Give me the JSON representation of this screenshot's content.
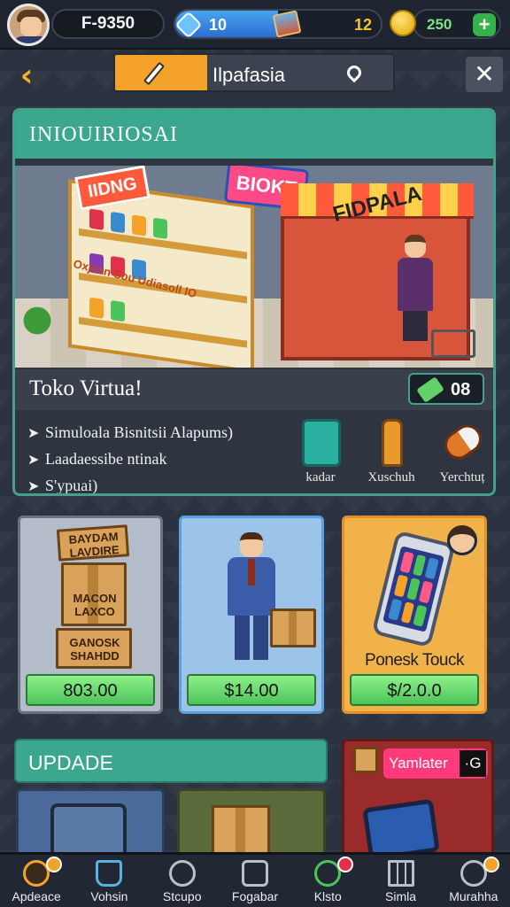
{
  "hud": {
    "money": "F-9350",
    "level": "10",
    "level_progress": 0.5,
    "level_right": "12",
    "gems": "250",
    "plus": "+"
  },
  "location": {
    "back_label": "‹",
    "name": "Ilpafasia",
    "close_label": "✕"
  },
  "store_card": {
    "header": "INIOUIRIOSAI",
    "signs": [
      "BIOKT",
      "IIDNG",
      "FIDPALA"
    ],
    "shop_label": "Oxjean Sou Udiasoll lO",
    "title": "Toko Virtua!",
    "badge_count": "08",
    "features": [
      "Simuloala Bisnitsii Alapums)",
      "Laadaessibe ntinak",
      "S'ypuai)"
    ],
    "supplies": [
      {
        "label": "kadar",
        "icon": "box-icon"
      },
      {
        "label": "Xuschuh",
        "icon": "bottle-icon"
      },
      {
        "label": "Yerchtuț",
        "icon": "pill-icon"
      }
    ]
  },
  "products": [
    {
      "price": "803.00",
      "box_labels": [
        "BAYDAM LAVDIRE",
        "MACON LAXCO",
        "GANOSK SHAHDD"
      ]
    },
    {
      "price": "$14.00"
    },
    {
      "name": "Ponesk Touck",
      "price": "$/2.0.0"
    }
  ],
  "update": {
    "header": "UPDADE",
    "promo_badge": "Yamlater",
    "promo_g": "·G"
  },
  "nav": [
    {
      "label": "Apdeace",
      "icon": "store-icon",
      "active": true,
      "badge": "orange"
    },
    {
      "label": "Vohsin",
      "icon": "cup-icon"
    },
    {
      "label": "Stcupo",
      "icon": "clock-icon"
    },
    {
      "label": "Fogabar",
      "icon": "bag-icon"
    },
    {
      "label": "Klsto",
      "icon": "pin-icon",
      "badge": "red"
    },
    {
      "label": "Simla",
      "icon": "grid-icon"
    },
    {
      "label": "Murahha",
      "icon": "profile-icon",
      "badge": "orange"
    }
  ],
  "colors": {
    "accent_teal": "#3aa78e",
    "accent_orange": "#f5a22a",
    "price_green": "#4cc45a",
    "background": "#2b3340"
  }
}
